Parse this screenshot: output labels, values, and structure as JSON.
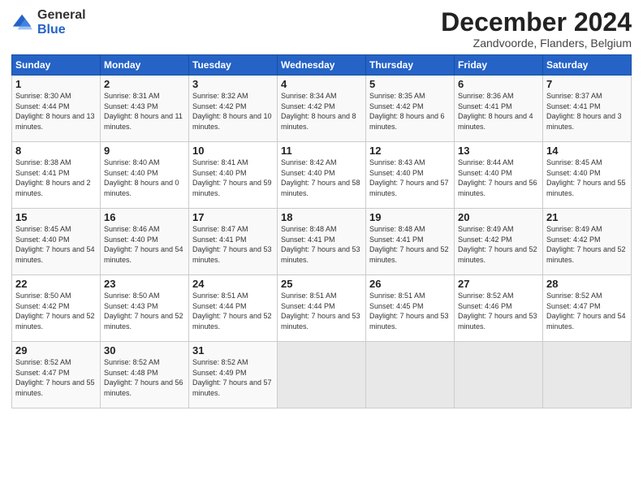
{
  "logo": {
    "general": "General",
    "blue": "Blue"
  },
  "title": "December 2024",
  "subtitle": "Zandvoorde, Flanders, Belgium",
  "headers": [
    "Sunday",
    "Monday",
    "Tuesday",
    "Wednesday",
    "Thursday",
    "Friday",
    "Saturday"
  ],
  "weeks": [
    [
      {
        "day": "1",
        "sunrise": "Sunrise: 8:30 AM",
        "sunset": "Sunset: 4:44 PM",
        "daylight": "Daylight: 8 hours and 13 minutes."
      },
      {
        "day": "2",
        "sunrise": "Sunrise: 8:31 AM",
        "sunset": "Sunset: 4:43 PM",
        "daylight": "Daylight: 8 hours and 11 minutes."
      },
      {
        "day": "3",
        "sunrise": "Sunrise: 8:32 AM",
        "sunset": "Sunset: 4:42 PM",
        "daylight": "Daylight: 8 hours and 10 minutes."
      },
      {
        "day": "4",
        "sunrise": "Sunrise: 8:34 AM",
        "sunset": "Sunset: 4:42 PM",
        "daylight": "Daylight: 8 hours and 8 minutes."
      },
      {
        "day": "5",
        "sunrise": "Sunrise: 8:35 AM",
        "sunset": "Sunset: 4:42 PM",
        "daylight": "Daylight: 8 hours and 6 minutes."
      },
      {
        "day": "6",
        "sunrise": "Sunrise: 8:36 AM",
        "sunset": "Sunset: 4:41 PM",
        "daylight": "Daylight: 8 hours and 4 minutes."
      },
      {
        "day": "7",
        "sunrise": "Sunrise: 8:37 AM",
        "sunset": "Sunset: 4:41 PM",
        "daylight": "Daylight: 8 hours and 3 minutes."
      }
    ],
    [
      {
        "day": "8",
        "sunrise": "Sunrise: 8:38 AM",
        "sunset": "Sunset: 4:41 PM",
        "daylight": "Daylight: 8 hours and 2 minutes."
      },
      {
        "day": "9",
        "sunrise": "Sunrise: 8:40 AM",
        "sunset": "Sunset: 4:40 PM",
        "daylight": "Daylight: 8 hours and 0 minutes."
      },
      {
        "day": "10",
        "sunrise": "Sunrise: 8:41 AM",
        "sunset": "Sunset: 4:40 PM",
        "daylight": "Daylight: 7 hours and 59 minutes."
      },
      {
        "day": "11",
        "sunrise": "Sunrise: 8:42 AM",
        "sunset": "Sunset: 4:40 PM",
        "daylight": "Daylight: 7 hours and 58 minutes."
      },
      {
        "day": "12",
        "sunrise": "Sunrise: 8:43 AM",
        "sunset": "Sunset: 4:40 PM",
        "daylight": "Daylight: 7 hours and 57 minutes."
      },
      {
        "day": "13",
        "sunrise": "Sunrise: 8:44 AM",
        "sunset": "Sunset: 4:40 PM",
        "daylight": "Daylight: 7 hours and 56 minutes."
      },
      {
        "day": "14",
        "sunrise": "Sunrise: 8:45 AM",
        "sunset": "Sunset: 4:40 PM",
        "daylight": "Daylight: 7 hours and 55 minutes."
      }
    ],
    [
      {
        "day": "15",
        "sunrise": "Sunrise: 8:45 AM",
        "sunset": "Sunset: 4:40 PM",
        "daylight": "Daylight: 7 hours and 54 minutes."
      },
      {
        "day": "16",
        "sunrise": "Sunrise: 8:46 AM",
        "sunset": "Sunset: 4:40 PM",
        "daylight": "Daylight: 7 hours and 54 minutes."
      },
      {
        "day": "17",
        "sunrise": "Sunrise: 8:47 AM",
        "sunset": "Sunset: 4:41 PM",
        "daylight": "Daylight: 7 hours and 53 minutes."
      },
      {
        "day": "18",
        "sunrise": "Sunrise: 8:48 AM",
        "sunset": "Sunset: 4:41 PM",
        "daylight": "Daylight: 7 hours and 53 minutes."
      },
      {
        "day": "19",
        "sunrise": "Sunrise: 8:48 AM",
        "sunset": "Sunset: 4:41 PM",
        "daylight": "Daylight: 7 hours and 52 minutes."
      },
      {
        "day": "20",
        "sunrise": "Sunrise: 8:49 AM",
        "sunset": "Sunset: 4:42 PM",
        "daylight": "Daylight: 7 hours and 52 minutes."
      },
      {
        "day": "21",
        "sunrise": "Sunrise: 8:49 AM",
        "sunset": "Sunset: 4:42 PM",
        "daylight": "Daylight: 7 hours and 52 minutes."
      }
    ],
    [
      {
        "day": "22",
        "sunrise": "Sunrise: 8:50 AM",
        "sunset": "Sunset: 4:42 PM",
        "daylight": "Daylight: 7 hours and 52 minutes."
      },
      {
        "day": "23",
        "sunrise": "Sunrise: 8:50 AM",
        "sunset": "Sunset: 4:43 PM",
        "daylight": "Daylight: 7 hours and 52 minutes."
      },
      {
        "day": "24",
        "sunrise": "Sunrise: 8:51 AM",
        "sunset": "Sunset: 4:44 PM",
        "daylight": "Daylight: 7 hours and 52 minutes."
      },
      {
        "day": "25",
        "sunrise": "Sunrise: 8:51 AM",
        "sunset": "Sunset: 4:44 PM",
        "daylight": "Daylight: 7 hours and 53 minutes."
      },
      {
        "day": "26",
        "sunrise": "Sunrise: 8:51 AM",
        "sunset": "Sunset: 4:45 PM",
        "daylight": "Daylight: 7 hours and 53 minutes."
      },
      {
        "day": "27",
        "sunrise": "Sunrise: 8:52 AM",
        "sunset": "Sunset: 4:46 PM",
        "daylight": "Daylight: 7 hours and 53 minutes."
      },
      {
        "day": "28",
        "sunrise": "Sunrise: 8:52 AM",
        "sunset": "Sunset: 4:47 PM",
        "daylight": "Daylight: 7 hours and 54 minutes."
      }
    ],
    [
      {
        "day": "29",
        "sunrise": "Sunrise: 8:52 AM",
        "sunset": "Sunset: 4:47 PM",
        "daylight": "Daylight: 7 hours and 55 minutes."
      },
      {
        "day": "30",
        "sunrise": "Sunrise: 8:52 AM",
        "sunset": "Sunset: 4:48 PM",
        "daylight": "Daylight: 7 hours and 56 minutes."
      },
      {
        "day": "31",
        "sunrise": "Sunrise: 8:52 AM",
        "sunset": "Sunset: 4:49 PM",
        "daylight": "Daylight: 7 hours and 57 minutes."
      },
      null,
      null,
      null,
      null
    ]
  ]
}
